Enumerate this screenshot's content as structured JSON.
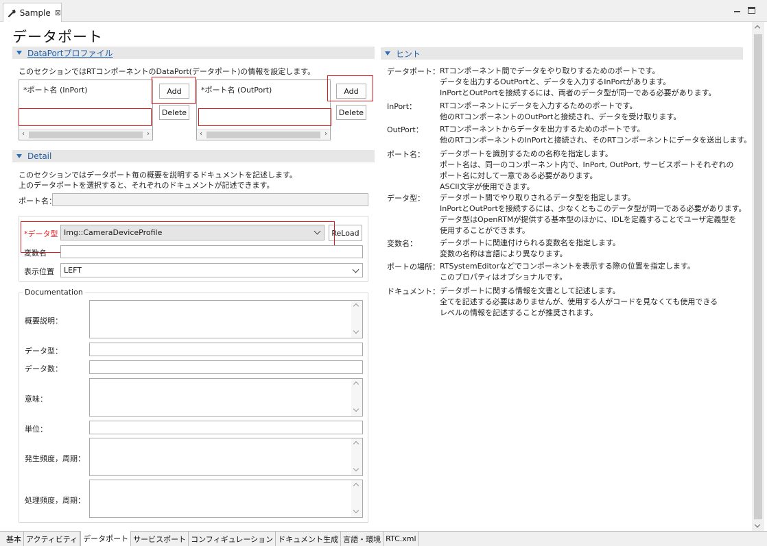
{
  "editor_tab": {
    "label": "Sample"
  },
  "page_title": "データポート",
  "dataport_profile": {
    "header": "DataPortプロファイル",
    "description": "このセクションではRTコンポーネントのDataPort(データポート)の情報を設定します。",
    "inport": {
      "label": "*ポート名 (InPort)",
      "add": "Add",
      "delete": "Delete"
    },
    "outport": {
      "label": "*ポート名 (OutPort)",
      "add": "Add",
      "delete": "Delete"
    }
  },
  "detail": {
    "header": "Detail",
    "desc1": "このセクションではデータポート毎の概要を説明するドキュメントを記述します。",
    "desc2": "上のデータポートを選択すると、それぞれのドキュメントが記述できます。",
    "port_name_label": "ポート名：",
    "data_type_label": "*データ型",
    "data_type_value": "Img::CameraDeviceProfile",
    "reload": "ReLoad",
    "var_name_label": "変数名",
    "position_label": "表示位置",
    "position_value": "LEFT",
    "documentation": {
      "legend": "Documentation",
      "summary": "概要説明：",
      "data_type": "データ型：",
      "data_count": "データ数：",
      "meaning": "意味：",
      "unit": "単位：",
      "frequency": "発生頻度，周期：",
      "processing": "処理頻度，周期："
    }
  },
  "hints": {
    "header": "ヒント",
    "items": [
      {
        "term": "データポート：",
        "lines": [
          "RTコンポーネント間でデータをやり取りするためのポートです。",
          "データを出力するOutPortと、データを入力するInPortがあります。",
          "InPortとOutPortを接続するには、両者のデータ型が同一である必要があります。"
        ]
      },
      {
        "term": "InPort：",
        "lines": [
          "RTコンポーネントにデータを入力するためのポートです。",
          "他のRTコンポーネントのOutPortと接続され、データを受け取ります。"
        ]
      },
      {
        "term": "OutPort：",
        "lines": [
          "RTコンポーネントからデータを出力するためのポートです。",
          "他のRTコンポーネントのInPortと接続され、そのRTコンポーネントにデータを送出します。"
        ]
      },
      {
        "term": "ポート名：",
        "lines": [
          "データポートを識別するための名称を指定します。",
          "ポート名は、同一のコンポーネント内で、InPort, OutPort, サービスポートそれぞれの",
          "ポート名に対して一意である必要があります。",
          "ASCII文字が使用できます。"
        ]
      },
      {
        "term": "データ型：",
        "lines": [
          "データポート間でやり取りされるデータ型を指定します。",
          "InPortとOutPortを接続するには、少なくともこのデータ型が同一である必要があります。",
          "データ型はOpenRTMが提供する基本型のほかに、IDLを定義することでユーザ定義型を",
          "使用することができます。"
        ]
      },
      {
        "term": "変数名：",
        "lines": [
          "データポートに関連付けられる変数名を指定します。",
          "変数の名称は言語により異なります。"
        ]
      },
      {
        "term": "ポートの場所：",
        "lines": [
          "RTSystemEditorなどでコンポーネントを表示する際の位置を指定します。",
          "このプロパティはオプショナルです。"
        ]
      },
      {
        "term": "ドキュメント：",
        "lines": [
          "データポートに関する情報を文書として記述します。",
          "全てを記述する必要はありませんが、使用する人がコードを見なくても使用できる",
          "レベルの情報を記述することが推奨されます。"
        ]
      }
    ]
  },
  "bottom_tabs": [
    "基本",
    "アクティビティ",
    "データポート",
    "サービスポート",
    "コンフィギュレーション",
    "ドキュメント生成",
    "言語・環境",
    "RTC.xml"
  ],
  "active_tab": "データポート"
}
